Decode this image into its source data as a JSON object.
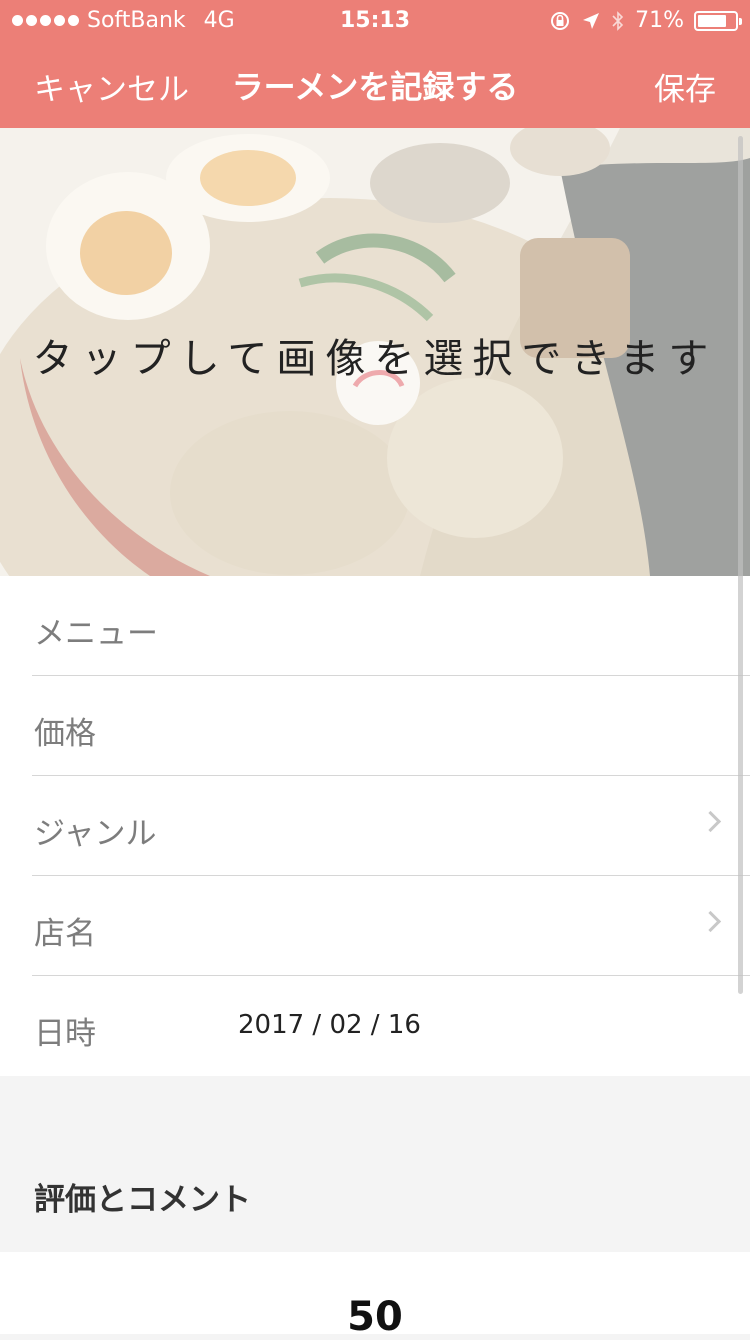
{
  "status_bar": {
    "carrier": "SoftBank",
    "network": "4G",
    "time": "15:13",
    "battery": "71%",
    "battery_level": 0.71,
    "icons": [
      "signal-dots-icon",
      "orientation-lock-icon",
      "location-arrow-icon",
      "bluetooth-icon",
      "battery-icon"
    ]
  },
  "nav": {
    "cancel_label": "キャンセル",
    "title": "ラーメンを記録する",
    "save_label": "保存"
  },
  "photo": {
    "hint": "タップして画像を選択できます"
  },
  "form": {
    "rows": [
      {
        "label": "メニュー",
        "value": ""
      },
      {
        "label": "価格",
        "value": ""
      },
      {
        "label": "ジャンル",
        "value": ""
      },
      {
        "label": "店名",
        "value": ""
      },
      {
        "label": "日時",
        "value": "2017 / 02 / 16"
      }
    ]
  },
  "rating_section": {
    "heading": "評価とコメント",
    "score": "50"
  },
  "colors": {
    "accent": "#ec7f77",
    "background": "#f4f4f4"
  }
}
